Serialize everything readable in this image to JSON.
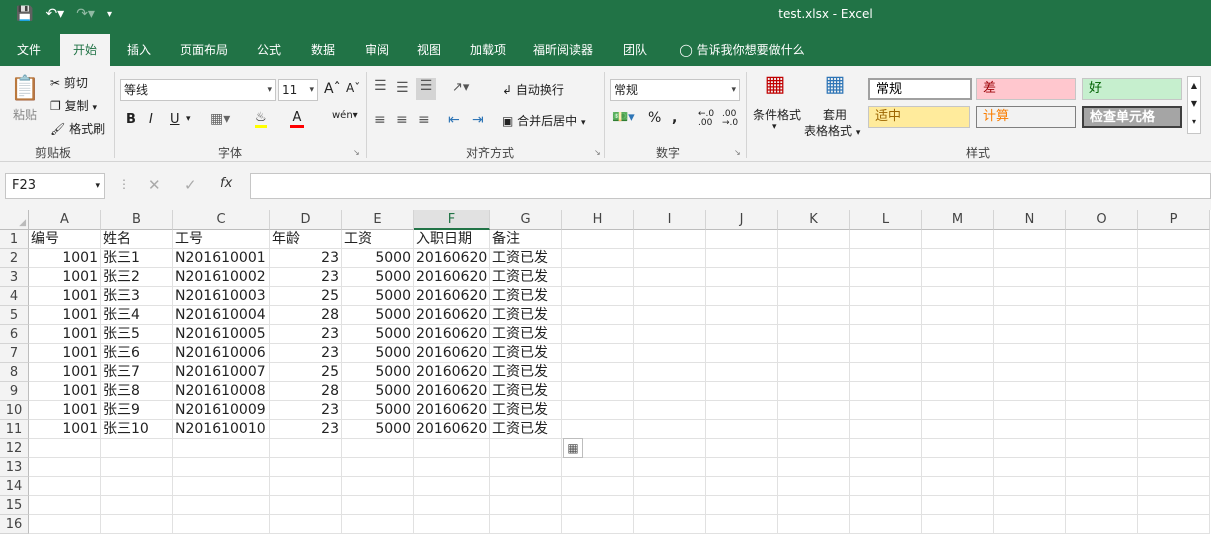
{
  "window": {
    "title": "test.xlsx  -  Excel"
  },
  "tabs": [
    "文件",
    "开始",
    "插入",
    "页面布局",
    "公式",
    "数据",
    "审阅",
    "视图",
    "加载项",
    "福昕阅读器",
    "团队"
  ],
  "tell_me": "告诉我你想要做什么",
  "clipboard": {
    "paste": "粘贴",
    "cut": "剪切",
    "copy": "复制",
    "format_painter": "格式刷",
    "label": "剪贴板"
  },
  "font": {
    "name": "等线",
    "size": "11",
    "label": "字体",
    "bold": "B",
    "italic": "I",
    "underline": "U"
  },
  "alignment": {
    "wrap": "自动换行",
    "merge": "合并后居中",
    "label": "对齐方式"
  },
  "number": {
    "format": "常规",
    "label": "数字"
  },
  "styles": {
    "conditional": "条件格式",
    "table_1": "套用",
    "table_2": "表格格式",
    "label": "样式",
    "cells": [
      {
        "text": "常规",
        "bg": "#ffffff",
        "fg": "#000000"
      },
      {
        "text": "差",
        "bg": "#ffc7ce",
        "fg": "#9c0006"
      },
      {
        "text": "好",
        "bg": "#c6efce",
        "fg": "#006100"
      },
      {
        "text": "适中",
        "bg": "#ffeb9c",
        "fg": "#9c6500"
      },
      {
        "text": "计算",
        "bg": "#f2f2f2",
        "fg": "#fa7d00"
      },
      {
        "text": "检查单元格",
        "bg": "#a5a5a5",
        "fg": "#ffffff"
      }
    ]
  },
  "namebox": "F23",
  "columns": [
    "A",
    "B",
    "C",
    "D",
    "E",
    "F",
    "G",
    "H",
    "I",
    "J",
    "K",
    "L",
    "M",
    "N",
    "O",
    "P"
  ],
  "selected_column": "F",
  "rows": [
    [
      "编号",
      "姓名",
      "工号",
      "年龄",
      "工资",
      "入职日期",
      "备注"
    ],
    [
      "1001",
      "张三1",
      "N201610001",
      "23",
      "5000",
      "20160620",
      "工资已发"
    ],
    [
      "1001",
      "张三2",
      "N201610002",
      "23",
      "5000",
      "20160620",
      "工资已发"
    ],
    [
      "1001",
      "张三3",
      "N201610003",
      "25",
      "5000",
      "20160620",
      "工资已发"
    ],
    [
      "1001",
      "张三4",
      "N201610004",
      "28",
      "5000",
      "20160620",
      "工资已发"
    ],
    [
      "1001",
      "张三5",
      "N201610005",
      "23",
      "5000",
      "20160620",
      "工资已发"
    ],
    [
      "1001",
      "张三6",
      "N201610006",
      "23",
      "5000",
      "20160620",
      "工资已发"
    ],
    [
      "1001",
      "张三7",
      "N201610007",
      "25",
      "5000",
      "20160620",
      "工资已发"
    ],
    [
      "1001",
      "张三8",
      "N201610008",
      "28",
      "5000",
      "20160620",
      "工资已发"
    ],
    [
      "1001",
      "张三9",
      "N201610009",
      "23",
      "5000",
      "20160620",
      "工资已发"
    ],
    [
      "1001",
      "张三10",
      "N201610010",
      "23",
      "5000",
      "20160620",
      "工资已发"
    ],
    [],
    [],
    [],
    [],
    []
  ],
  "row_numbers": [
    "1",
    "2",
    "3",
    "4",
    "5",
    "6",
    "7",
    "8",
    "9",
    "10",
    "11",
    "12",
    "13",
    "14",
    "15",
    "16"
  ]
}
